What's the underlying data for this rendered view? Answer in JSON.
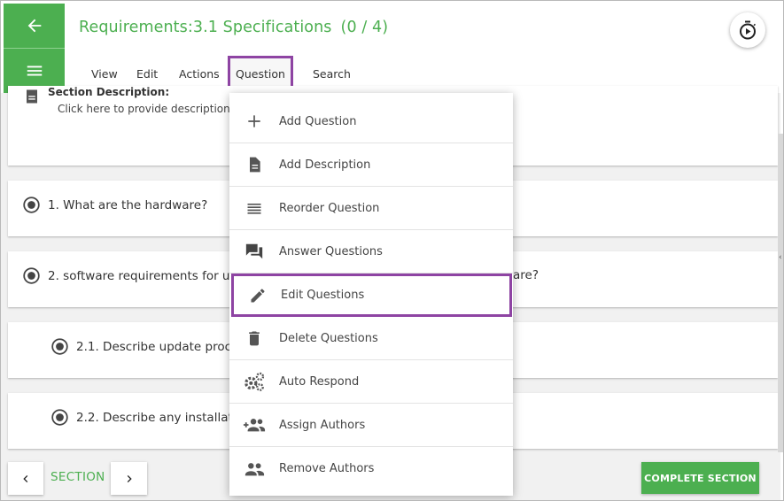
{
  "header": {
    "title": "Requirements:3.1 Specifications",
    "count": "(0 / 4)"
  },
  "menubar": {
    "view": "View",
    "edit": "Edit",
    "actions": "Actions",
    "question": "Question",
    "search": "Search"
  },
  "description": {
    "title": "Section Description:",
    "hint": "Click here to provide description"
  },
  "questions": [
    {
      "label": "1. What are the hardware?"
    },
    {
      "label": "2. software requirements for u"
    },
    {
      "label": "2.1. Describe update proc"
    },
    {
      "label": "2.2. Describe any installat"
    }
  ],
  "question_2_tail": "are?",
  "dropdown": {
    "items": [
      {
        "label": "Add Question",
        "icon": "plus-icon"
      },
      {
        "label": "Add Description",
        "icon": "document-icon"
      },
      {
        "label": "Reorder Question",
        "icon": "reorder-icon"
      },
      {
        "label": "Answer Questions",
        "icon": "chat-icon"
      },
      {
        "label": "Edit Questions",
        "icon": "pencil-icon"
      },
      {
        "label": "Delete Questions",
        "icon": "trash-icon"
      },
      {
        "label": "Auto Respond",
        "icon": "gears-icon"
      },
      {
        "label": "Assign Authors",
        "icon": "add-people-icon"
      },
      {
        "label": "Remove Authors",
        "icon": "people-icon"
      }
    ]
  },
  "footer": {
    "section_label": "SECTION",
    "complete_label": "COMPLETE SECTION"
  },
  "colors": {
    "accent": "#4caf50",
    "highlight": "#8e44a3"
  }
}
